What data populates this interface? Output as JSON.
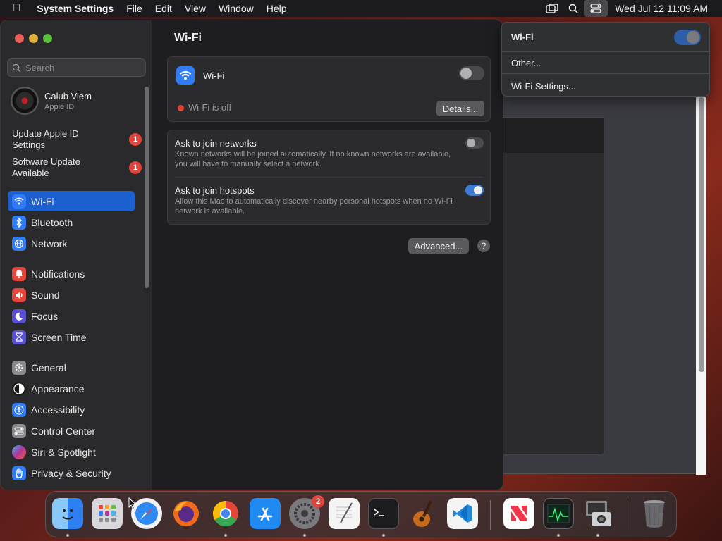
{
  "menubar": {
    "app": "System Settings",
    "items": [
      "File",
      "Edit",
      "View",
      "Window",
      "Help"
    ],
    "clock": "Wed Jul 12  11:09 AM"
  },
  "sidebar": {
    "search_placeholder": "Search",
    "account": {
      "name": "Calub Viem",
      "sub": "Apple ID"
    },
    "alerts": [
      {
        "label": "Update Apple ID Settings",
        "badge": "1"
      },
      {
        "label": "Software Update Available",
        "badge": "1"
      }
    ],
    "items": [
      {
        "label": "Wi-Fi",
        "icon": "wifi-icon",
        "color": "#2f7cf6"
      },
      {
        "label": "Bluetooth",
        "icon": "bluetooth-icon",
        "color": "#2f7cf6"
      },
      {
        "label": "Network",
        "icon": "globe-icon",
        "color": "#2f7cf6"
      },
      {
        "label": "Notifications",
        "icon": "bell-icon",
        "color": "#e5463a"
      },
      {
        "label": "Sound",
        "icon": "speaker-icon",
        "color": "#e5463a"
      },
      {
        "label": "Focus",
        "icon": "moon-icon",
        "color": "#5a4fd0"
      },
      {
        "label": "Screen Time",
        "icon": "hourglass-icon",
        "color": "#5a4fd0"
      },
      {
        "label": "General",
        "icon": "gear-icon",
        "color": "#8a8a8e"
      },
      {
        "label": "Appearance",
        "icon": "appearance-icon",
        "color": "#1a1a1a"
      },
      {
        "label": "Accessibility",
        "icon": "accessibility-icon",
        "color": "#2f7cf6"
      },
      {
        "label": "Control Center",
        "icon": "control-center-icon",
        "color": "#8a8a8e"
      },
      {
        "label": "Siri & Spotlight",
        "icon": "siri-icon",
        "color": "#b0359c"
      },
      {
        "label": "Privacy & Security",
        "icon": "hand-icon",
        "color": "#2f7cf6"
      }
    ]
  },
  "content": {
    "title": "Wi-Fi",
    "wifi_label": "Wi-Fi",
    "wifi_on": false,
    "status": "Wi-Fi is off",
    "details_button": "Details...",
    "ask_networks": {
      "title": "Ask to join networks",
      "desc": "Known networks will be joined automatically. If no known networks are available, you will have to manually select a network.",
      "on": false
    },
    "ask_hotspots": {
      "title": "Ask to join hotspots",
      "desc": "Allow this Mac to automatically discover nearby personal hotspots when no Wi-Fi network is available.",
      "on": true
    },
    "advanced_button": "Advanced...",
    "help_button": "?"
  },
  "wifi_menu": {
    "title": "Wi-Fi",
    "other": "Other...",
    "settings": "Wi-Fi Settings..."
  },
  "dock": {
    "apps": [
      "Finder",
      "Launchpad",
      "Safari",
      "Firefox",
      "Chrome",
      "App Store",
      "System Settings",
      "TextEdit",
      "Terminal",
      "GarageBand",
      "VS Code",
      "News",
      "Activity Monitor",
      "Image Capture",
      "Trash"
    ],
    "settings_badge": "2"
  },
  "colors": {
    "accent": "#1b5fd0",
    "badge": "#e0443a",
    "status_red": "#e0443a"
  }
}
